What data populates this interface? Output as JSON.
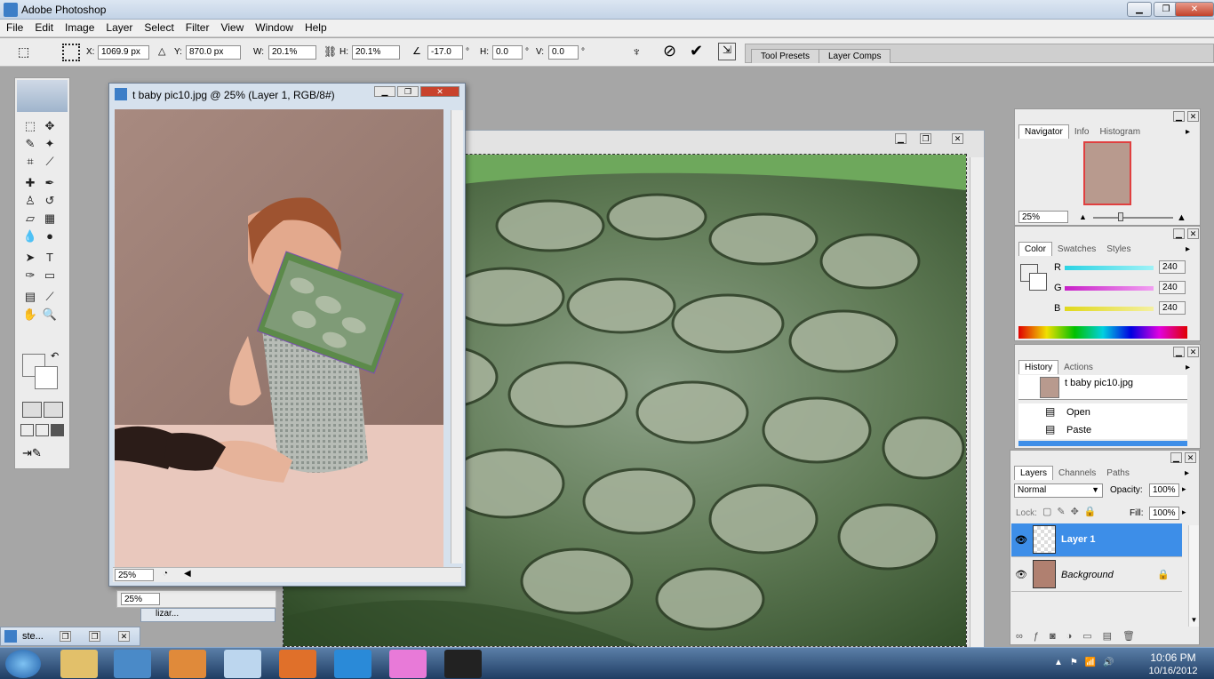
{
  "app": {
    "title": "Adobe Photoshop"
  },
  "window_controls": {
    "minimize": "▁",
    "restore": "❐",
    "close": "✕"
  },
  "menu": [
    "File",
    "Edit",
    "Image",
    "Layer",
    "Select",
    "Filter",
    "View",
    "Window",
    "Help"
  ],
  "options": {
    "x_label": "X:",
    "x": "1069.9 px",
    "y_label": "Y:",
    "y": "870.0 px",
    "w_label": "W:",
    "w": "20.1%",
    "h_label": "H:",
    "h": "20.1%",
    "angle": "-17.0",
    "angle_unit": "°",
    "hskew_label": "H:",
    "hskew": "0.0",
    "hskew_unit": "°",
    "vskew_label": "V:",
    "vskew": "0.0",
    "vskew_unit": "°",
    "cancel": "⃠",
    "commit": "✔"
  },
  "well_tabs": [
    "Tool Presets",
    "Layer Comps"
  ],
  "doc1": {
    "title": "t baby pic10.jpg @ 25% (Layer 1, RGB/8#)",
    "zoom": "25%"
  },
  "doc2": {
    "zoom": "25%"
  },
  "minimized_doc": {
    "title": "ste...",
    "sub": "lizar..."
  },
  "navigator": {
    "tabs": [
      "Navigator",
      "Info",
      "Histogram"
    ],
    "zoom": "25%"
  },
  "color": {
    "tabs": [
      "Color",
      "Swatches",
      "Styles"
    ],
    "r_label": "R",
    "r": "240",
    "g_label": "G",
    "g": "240",
    "b_label": "B",
    "b": "240",
    "accent_r": "#33c8d8",
    "accent_g": "#d42ad4",
    "accent_b": "#e8e020"
  },
  "history": {
    "tabs": [
      "History",
      "Actions"
    ],
    "snapshot": "t baby pic10.jpg",
    "items": [
      "Open",
      "Paste"
    ]
  },
  "layers": {
    "tabs": [
      "Layers",
      "Channels",
      "Paths"
    ],
    "blend": "Normal",
    "opacity_label": "Opacity:",
    "opacity": "100%",
    "lock_label": "Lock:",
    "fill_label": "Fill:",
    "fill": "100%",
    "rows": [
      {
        "name": "Layer 1",
        "selected": true
      },
      {
        "name": "Background",
        "selected": false
      }
    ]
  },
  "taskbar": {
    "time": "10:06 PM",
    "date": "10/16/2012"
  }
}
